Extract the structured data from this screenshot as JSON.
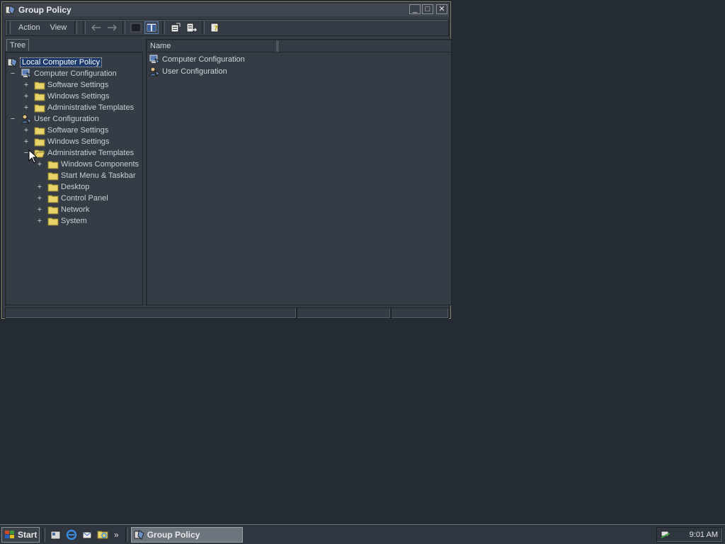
{
  "window": {
    "title": "Group Policy",
    "controls": {
      "minimize": "_",
      "maximize": "□",
      "close": "✕"
    }
  },
  "menu": {
    "action": "Action",
    "view": "View"
  },
  "toolbar": {
    "icons": [
      "back-arrow-icon",
      "forward-arrow-icon",
      "console-tree-icon",
      "show-hide-tree-icon",
      "properties-icon",
      "export-list-icon",
      "help-icon"
    ]
  },
  "tree": {
    "tab_label": "Tree",
    "root": "Local Computer Policy",
    "computer_configuration": "Computer Configuration",
    "cc_software_settings": "Software Settings",
    "cc_windows_settings": "Windows Settings",
    "cc_administrative_templates": "Administrative Templates",
    "user_configuration": "User Configuration",
    "uc_software_settings": "Software Settings",
    "uc_windows_settings": "Windows Settings",
    "uc_administrative_templates": "Administrative Templates",
    "windows_components": "Windows Components",
    "start_menu_taskbar": "Start Menu & Taskbar",
    "desktop": "Desktop",
    "control_panel": "Control Panel",
    "network": "Network",
    "system": "System",
    "plus": "+",
    "minus": "−"
  },
  "list": {
    "column_name": "Name",
    "items": [
      "Computer Configuration",
      "User Configuration"
    ]
  },
  "taskbar": {
    "start_label": "Start",
    "chevron": "»",
    "task_label": "Group Policy",
    "clock": "9:01 AM"
  },
  "colors": {
    "desktop": "#252b33",
    "window": "#353c45",
    "selection": "#1c3a6a",
    "folder": "#e8d36a"
  }
}
